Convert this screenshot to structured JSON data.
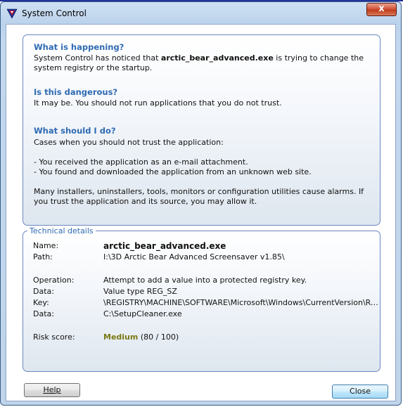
{
  "window": {
    "title": "System Control"
  },
  "titlebar": {
    "close_glyph": "x"
  },
  "info": {
    "q1": "What is happening?",
    "a1_pre": "System Control has noticed that ",
    "a1_app": "arctic_bear_advanced.exe",
    "a1_post": " is trying to change the system registry or the startup.",
    "q2": "Is this dangerous?",
    "a2": "It may be. You should not run applications that you do not trust.",
    "q3": "What should I do?",
    "a3_intro": "Cases when you should not trust the application:",
    "a3_items": [
      "- You received the application as an e-mail attachment.",
      "- You found and downloaded the application from an unknown web site."
    ],
    "a3_footer": "Many installers, uninstallers, tools, monitors or configuration utilities cause alarms. If you trust the application and its source, you may allow it."
  },
  "technical": {
    "legend": "Technical details",
    "name_label": "Name:",
    "name_value": "arctic_bear_advanced.exe",
    "path_label": "Path:",
    "path_value": "I:\\3D Arctic Bear Advanced Screensaver v1.85\\",
    "operation_label": "Operation:",
    "operation_value": "Attempt to add a value into a protected registry key.",
    "data1_label": "Data:",
    "data1_value": "Value type REG_SZ",
    "key_label": "Key:",
    "key_value": "\\REGISTRY\\MACHINE\\SOFTWARE\\Microsoft\\Windows\\CurrentVersion\\RunO...",
    "data2_label": "Data:",
    "data2_value": "C:\\SetupCleaner.exe",
    "risk_label": "Risk score:",
    "risk_level": "Medium",
    "risk_score": "(80 / 100)",
    "risk_color": "#7a7a14"
  },
  "buttons": {
    "help": "Help",
    "close": "Close"
  }
}
